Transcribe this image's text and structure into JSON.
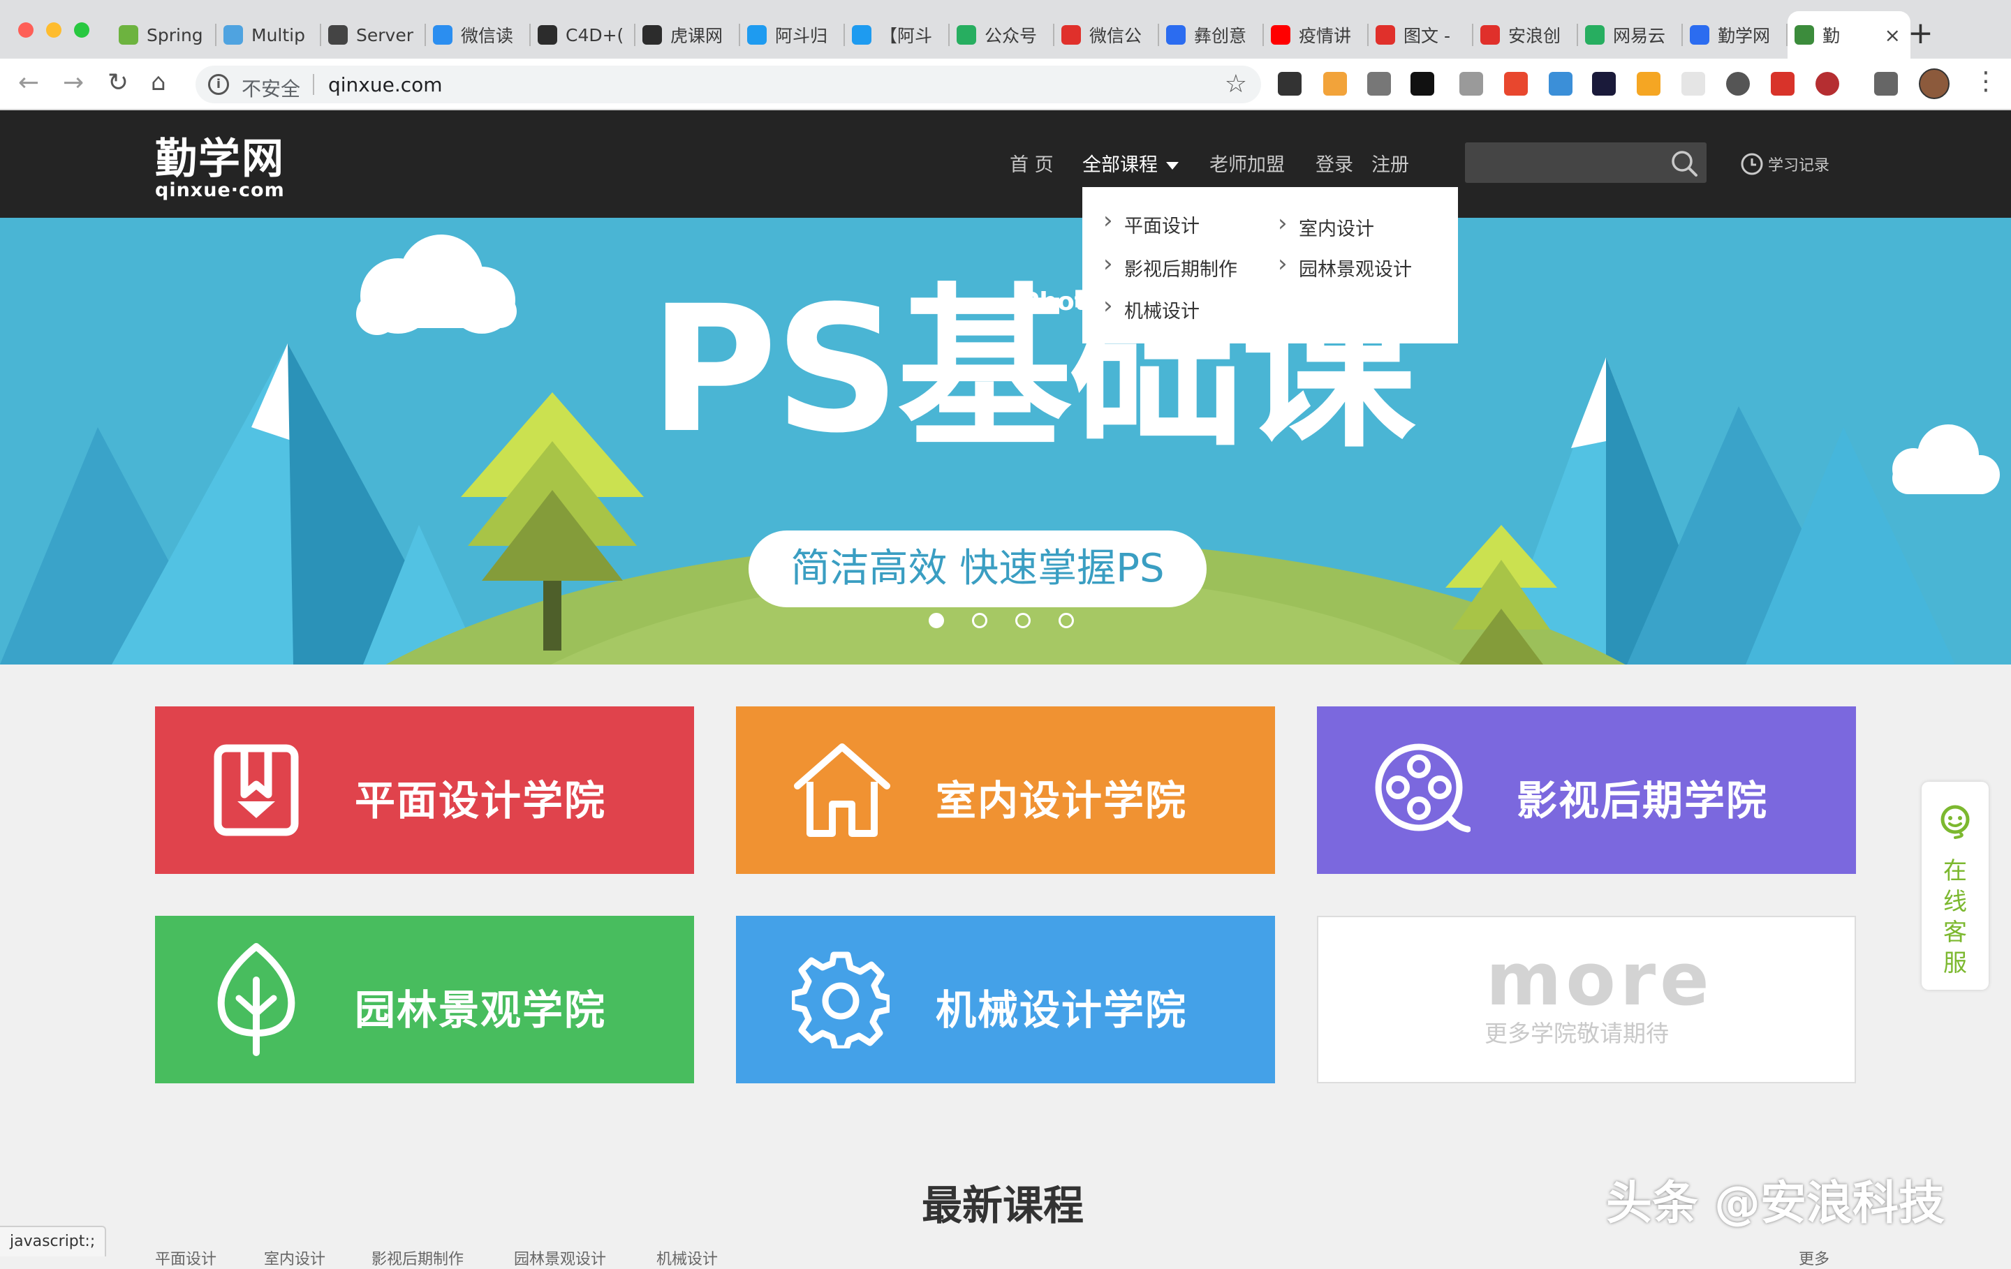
{
  "browser": {
    "tabs": [
      {
        "label": "Spring",
        "color": "#6db33f"
      },
      {
        "label": "Multip",
        "color": "#4fa3e0"
      },
      {
        "label": "Server",
        "color": "#444444"
      },
      {
        "label": "微信读",
        "color": "#2b8ef0"
      },
      {
        "label": "C4D+(",
        "color": "#2c2c2c"
      },
      {
        "label": "虎课网",
        "color": "#2c2c2c"
      },
      {
        "label": "阿斗归",
        "color": "#1e9bf0"
      },
      {
        "label": "【阿斗",
        "color": "#1e9bf0"
      },
      {
        "label": "公众号",
        "color": "#27ae60"
      },
      {
        "label": "微信公",
        "color": "#e0302b"
      },
      {
        "label": "彝创意",
        "color": "#2b6cf0"
      },
      {
        "label": "疫情讲",
        "color": "#ff0000"
      },
      {
        "label": "图文 -",
        "color": "#e0302b"
      },
      {
        "label": "安浪创",
        "color": "#e0302b"
      },
      {
        "label": "网易云",
        "color": "#27ae60"
      },
      {
        "label": "勤学网",
        "color": "#2b6cf0"
      },
      {
        "label": "勤",
        "color": "#3c8c3c",
        "active": true
      }
    ],
    "address": {
      "security": "不安全",
      "url": "qinxue.com"
    },
    "status_text": "javascript:;"
  },
  "header": {
    "logo_cn": "勤学网",
    "logo_en": "qinxue·com",
    "nav": [
      {
        "label": "首 页"
      },
      {
        "label": "全部课程"
      },
      {
        "label": "老师加盟"
      },
      {
        "label": "登录"
      },
      {
        "label": "注册"
      }
    ],
    "search_placeholder": "",
    "history_label": "学习记录"
  },
  "dropdown": {
    "items": [
      {
        "label": "平面设计"
      },
      {
        "label": "室内设计"
      },
      {
        "label": "影视后期制作"
      },
      {
        "label": "园林景观设计"
      },
      {
        "label": "机械设计"
      }
    ]
  },
  "banner": {
    "title": "PS基础课",
    "subtitle": "简洁高效 快速掌握PS",
    "tag": "Photo",
    "dots": 4,
    "active_dot": 0
  },
  "tiles": [
    {
      "label": "平面设计学院",
      "color": "#e0434c",
      "icon": "download-box-icon"
    },
    {
      "label": "室内设计学院",
      "color": "#f09232",
      "icon": "house-icon"
    },
    {
      "label": "影视后期学院",
      "color": "#7b68de",
      "icon": "film-reel-icon"
    },
    {
      "label": "园林景观学院",
      "color": "#48bd5e",
      "icon": "leaf-icon"
    },
    {
      "label": "机械设计学院",
      "color": "#44a1e8",
      "icon": "gear-icon"
    }
  ],
  "more_tile": {
    "title": "more",
    "subtitle": "更多学院敬请期待"
  },
  "online_service": "在线客服",
  "latest": {
    "title": "最新课程",
    "categories": [
      "平面设计",
      "室内设计",
      "影视后期制作",
      "园林景观设计",
      "机械设计"
    ],
    "more": "更多"
  },
  "watermark": "头条 @安浪科技"
}
